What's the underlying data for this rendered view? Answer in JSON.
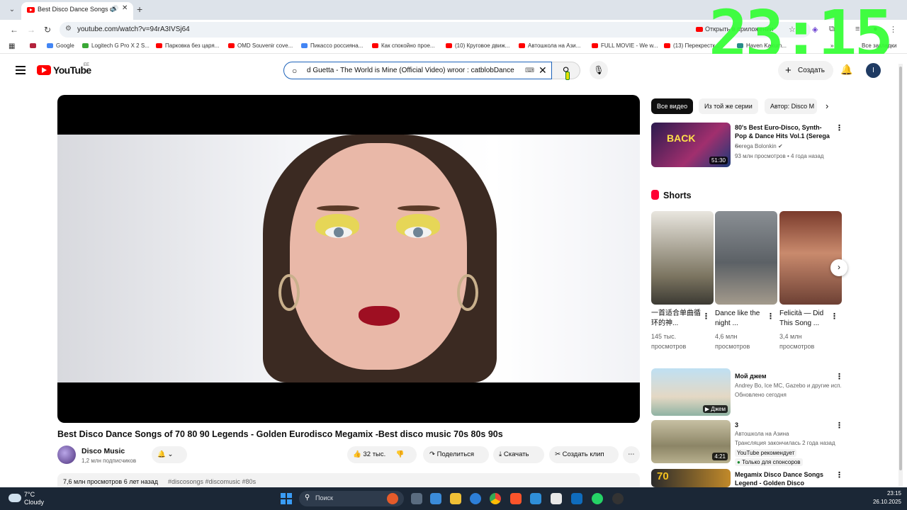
{
  "browser": {
    "tab_title": "Best Disco Dance Songs of",
    "url": "youtube.com/watch?v=94rA3IVSj64",
    "open_in_app": "Открыть в приложении",
    "bookmarks": [
      "Google",
      "Logitech G Pro X 2 S...",
      "Парковка без царя...",
      "OMD Souvenir cove...",
      "Пикассо россиянa...",
      "Как спокойно прое...",
      "(10) Круговое движ...",
      "Автошкола на Ази...",
      "FULL MOVIE - We w...",
      "(13) Перекрестк...",
      "Haven Kakum...",
      "Все закладки"
    ]
  },
  "clock": {
    "text": "23:15"
  },
  "youtube": {
    "logo_text": "YouTube",
    "country": "EE",
    "search_text": "d Guetta - The World is Mine (Official Video) wroor : catblobDance",
    "create_label": "Создать",
    "avatar_letter": "I"
  },
  "video": {
    "title": "Best Disco Dance Songs of 70 80 90 Legends - Golden Eurodisco Megamix -Best disco music 70s 80s 90s",
    "channel": "Disco Music",
    "subscribers": "1,2 млн подписчиков",
    "likes": "32 тыс.",
    "share": "Поделиться",
    "download": "Скачать",
    "clip": "Создать клип",
    "views_date": "7,6 млн просмотров  6 лет назад",
    "hashtags": "#discosongs #discomusic #80s"
  },
  "chips": [
    "Все видео",
    "Из той же серии",
    "Автор: Disco M"
  ],
  "related_top": {
    "title": "80's Best Euro-Disco, Synth-Pop & Dance Hits Vol.1 (Serega ...",
    "channel": "Serega Bolonkin",
    "meta": "93 млн просмотров • 4 года назад",
    "duration": "51:30"
  },
  "shorts": {
    "heading": "Shorts",
    "items": [
      {
        "title": "一首适合单曲循环的神...",
        "views": "145 тыс.",
        "views2": "просмотров"
      },
      {
        "title": "Dance like the night ...",
        "views": "4,6 млн",
        "views2": "просмотров"
      },
      {
        "title": "Felicità — Did This Song ...",
        "views": "3,4 млн",
        "views2": "просмотров"
      }
    ]
  },
  "related_list": [
    {
      "title": "Мой джем",
      "channel": "Andrey Bo, Ice MC, Gazebo и другие исп...",
      "meta": "Обновлено сегодня",
      "badge": "Джем"
    },
    {
      "title": "3",
      "channel": "Автошкола на Азина",
      "meta": "Трансляция закончилась 2 года назад",
      "rec": "YouTube рекомендует",
      "sponsor": "Только для спонсоров",
      "duration": "4:21"
    },
    {
      "title": "Megamix Disco Dance Songs Legend - Golden Disco Greate...",
      "thumb_text": "70"
    }
  ],
  "taskbar": {
    "temp": "7°C",
    "weather": "Cloudy",
    "search_placeholder": "Поиск",
    "time": "23:15",
    "date": "26.10.2025"
  }
}
